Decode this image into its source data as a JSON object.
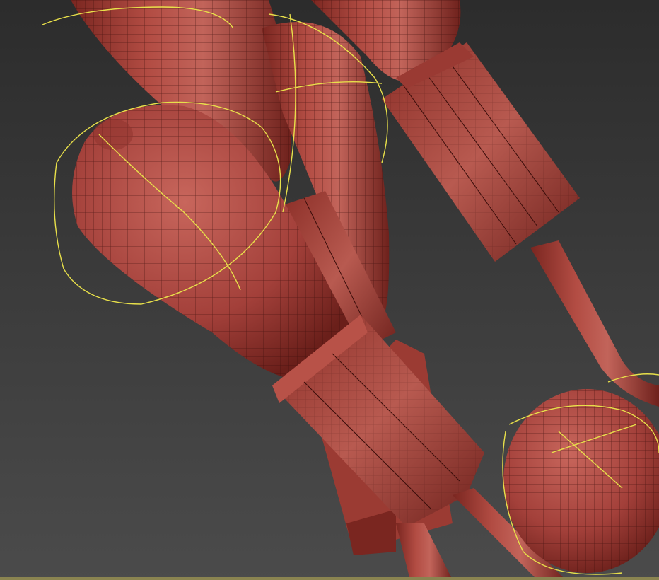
{
  "viewport": {
    "background_top": "#2f2f2f",
    "background_bottom": "#4a4a4a",
    "mesh_color": "#a8443d",
    "mesh_light": "#c2645a",
    "mesh_dark": "#6e211c",
    "wire_color": "#3a0d0a",
    "gizmo_color": "#e8e04a",
    "bottom_edge_color": "#8a8450"
  }
}
